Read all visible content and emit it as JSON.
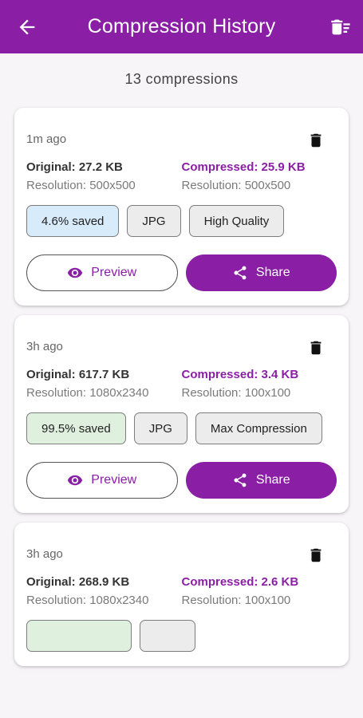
{
  "header": {
    "title": "Compression History",
    "back_icon": "arrow-back-icon",
    "clear_icon": "clear-all-icon"
  },
  "summary": "13 compressions",
  "colors": {
    "primary": "#8a1fa6",
    "saved_blue": "#d8ebfb",
    "saved_green": "#dff0df"
  },
  "items": [
    {
      "time": "1m ago",
      "original": "Original: 27.2 KB",
      "original_res": "Resolution: 500x500",
      "compressed": "Compressed: 25.9 KB",
      "compressed_res": "Resolution: 500x500",
      "saved": "4.6% saved",
      "format": "JPG",
      "quality": "High Quality",
      "preview": "Preview",
      "share": "Share"
    },
    {
      "time": "3h ago",
      "original": "Original: 617.7 KB",
      "original_res": "Resolution: 1080x2340",
      "compressed": "Compressed: 3.4 KB",
      "compressed_res": "Resolution: 100x100",
      "saved": "99.5% saved",
      "format": "JPG",
      "quality": "Max Compression",
      "preview": "Preview",
      "share": "Share"
    },
    {
      "time": "3h ago",
      "original": "Original: 268.9 KB",
      "original_res": "Resolution: 1080x2340",
      "compressed": "Compressed: 2.6 KB",
      "compressed_res": "Resolution: 100x100",
      "saved": "",
      "format": "",
      "quality": "",
      "preview": "",
      "share": ""
    }
  ]
}
